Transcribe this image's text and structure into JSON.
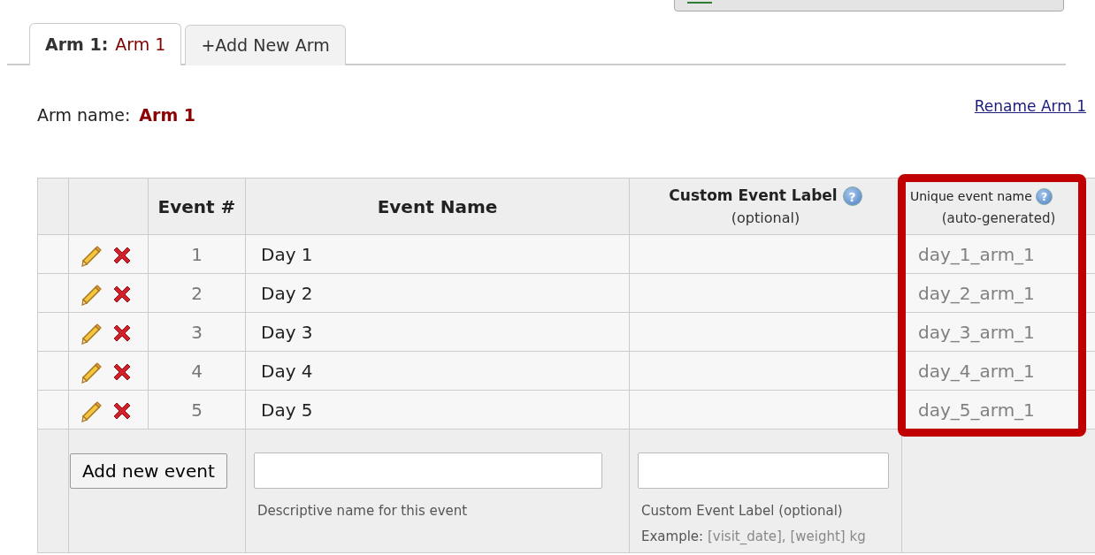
{
  "tabs": [
    {
      "prefix": "Arm 1:",
      "label": "Arm 1",
      "selected": true
    },
    {
      "label": "+Add New Arm",
      "selected": false
    }
  ],
  "arm_name": {
    "label": "Arm name:",
    "value": "Arm 1"
  },
  "rename_link": "Rename Arm 1",
  "table": {
    "columns": [
      {
        "label": "Event #"
      },
      {
        "label": "Event Name"
      },
      {
        "label": "Custom Event Label",
        "sublabel": "(optional)",
        "help": "?"
      },
      {
        "label": "Unique event name",
        "sublabel": "(auto-generated)",
        "help": "?",
        "highlighted": true
      }
    ],
    "rows": [
      {
        "number": "1",
        "name": "Day 1",
        "unique_name": "day_1_arm_1"
      },
      {
        "number": "2",
        "name": "Day 2",
        "unique_name": "day_2_arm_1"
      },
      {
        "number": "3",
        "name": "Day 3",
        "unique_name": "day_3_arm_1"
      },
      {
        "number": "4",
        "name": "Day 4",
        "unique_name": "day_4_arm_1"
      },
      {
        "number": "5",
        "name": "Day 5",
        "unique_name": "day_5_arm_1"
      }
    ]
  },
  "new_event": {
    "button": "Add new event",
    "name_hint": "Descriptive name for this event",
    "label_hint": "Custom Event Label (optional)",
    "example_label": "Example:",
    "example_value": "[visit_date], [weight] kg"
  }
}
